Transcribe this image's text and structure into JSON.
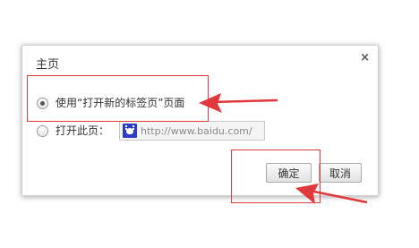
{
  "dialog": {
    "title": "主页",
    "close_glyph": "×",
    "close_icon": "close-icon",
    "options": [
      {
        "label": "使用“打开新的标签页”页面",
        "checked": true
      },
      {
        "label": "打开此页：",
        "checked": false
      }
    ],
    "url_field": {
      "value": "http://www.baidu.com/",
      "favicon": "baidu-paw-icon"
    },
    "buttons": {
      "ok_label": "确定",
      "cancel_label": "取消"
    }
  },
  "annotations": {
    "color": "#e0383b"
  }
}
